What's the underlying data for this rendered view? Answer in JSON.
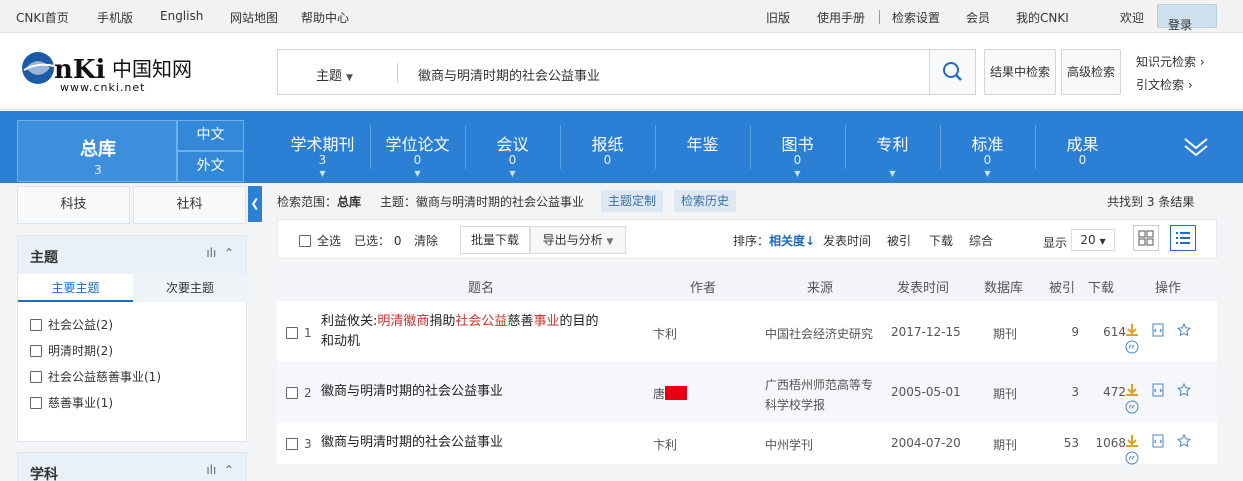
{
  "topbar": {
    "left": [
      "CNKI首页",
      "手机版",
      "English",
      "网站地图",
      "帮助中心"
    ],
    "right": [
      "旧版",
      "使用手册",
      "检索设置",
      "会员",
      "我的CNKI",
      "欢迎"
    ],
    "login": "登录"
  },
  "header": {
    "logo_text": "CNKI中国知网",
    "logo_url": "www.cnki.net",
    "search_type": "主题",
    "search_query": "徽商与明清时期的社会公益事业",
    "btn_result_search": "结果中检索",
    "btn_advanced": "高级检索",
    "link_knowledge": "知识元检索",
    "link_citation": "引文检索"
  },
  "nav": {
    "zongku": {
      "label": "总库",
      "count": "3"
    },
    "sub": [
      "中文",
      "外文"
    ],
    "items": [
      {
        "label": "学术期刊",
        "count": "3"
      },
      {
        "label": "学位论文",
        "count": "0"
      },
      {
        "label": "会议",
        "count": "0"
      },
      {
        "label": "报纸",
        "count": "0"
      },
      {
        "label": "年鉴",
        "count": ""
      },
      {
        "label": "图书",
        "count": "0"
      },
      {
        "label": "专利",
        "count": ""
      },
      {
        "label": "标准",
        "count": "0"
      },
      {
        "label": "成果",
        "count": "0"
      }
    ]
  },
  "left": {
    "seg": [
      "科技",
      "社科"
    ],
    "topic_panel": {
      "title": "主题",
      "tabs": [
        "主要主题",
        "次要主题"
      ],
      "items": [
        "社会公益(2)",
        "明清时期(2)",
        "社会公益慈善事业(1)",
        "慈善事业(1)"
      ]
    },
    "subject_panel": {
      "title": "学科"
    }
  },
  "crumb": {
    "scope_label": "检索范围：",
    "scope_value": "总库",
    "topic_label": "主题：",
    "topic_value": "徽商与明清时期的社会公益事业",
    "btn_custom": "主题定制",
    "btn_history": "检索历史",
    "found_prefix": "共找到",
    "found_count": "3",
    "found_suffix": "条结果"
  },
  "toolbar": {
    "select_all": "全选",
    "selected_label": "已选：",
    "selected_count": "0",
    "clear": "清除",
    "batch_download": "批量下载",
    "export": "导出与分析",
    "sort_label": "排序：",
    "sort_options": [
      "相关度",
      "发表时间",
      "被引",
      "下载",
      "综合"
    ],
    "display_label": "显示",
    "display_value": "20"
  },
  "table": {
    "headers": [
      "题名",
      "作者",
      "来源",
      "发表时间",
      "数据库",
      "被引",
      "下载",
      "操作"
    ],
    "rows": [
      {
        "idx": "1",
        "title_parts": [
          "利益攸关:",
          "明清徽商",
          "捐助",
          "社会公益",
          "慈善",
          "事业",
          "的目的"
        ],
        "title_line2": "和动机",
        "author": "卞利",
        "source": "中国社会经济史研究",
        "date": "2017-12-15",
        "db": "期刊",
        "cited": "9",
        "downloads": "614"
      },
      {
        "idx": "2",
        "title": "徽商与明清时期的社会公益事业",
        "author": "唐",
        "source_line1": "广西梧州师范高等专",
        "source_line2": "科学校学报",
        "date": "2005-05-01",
        "db": "期刊",
        "cited": "3",
        "downloads": "472"
      },
      {
        "idx": "3",
        "title": "徽商与明清时期的社会公益事业",
        "author": "卞利",
        "source": "中州学刊",
        "date": "2004-07-20",
        "db": "期刊",
        "cited": "53",
        "downloads": "1068"
      }
    ]
  },
  "colors": {
    "nav_blue": "#2b7fd4",
    "highlight_red": "#c8332a",
    "link_blue": "#1e6bc0"
  }
}
